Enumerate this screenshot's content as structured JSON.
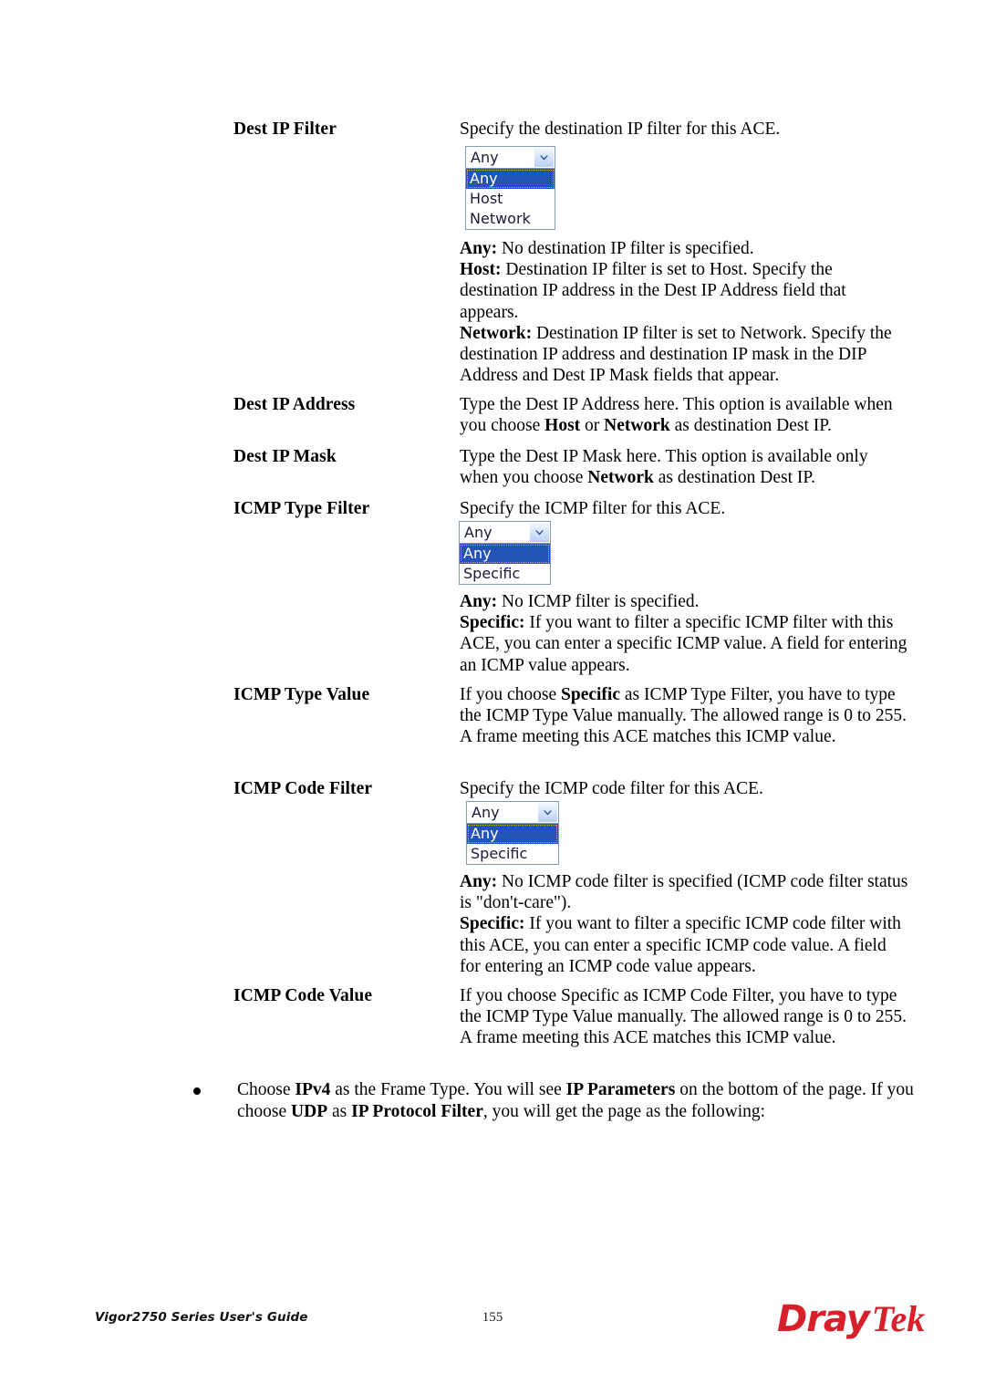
{
  "document": {
    "footer": {
      "left_text": "Vigor2750 Series User's Guide",
      "page_number": "155",
      "logo_part1": "Dray",
      "logo_part2": "Tek",
      "logo_color": "#d8202a"
    }
  },
  "entries": [
    {
      "term": "Dest IP Filter",
      "lead": "Specify the destination IP filter for this ACE.",
      "dropdown": {
        "name": "dest-ip-filter-select",
        "value": "Any",
        "options": [
          "Any",
          "Host",
          "Network"
        ],
        "selected_index": 0,
        "arrow_icon": "chevron-down-icon"
      },
      "details": [
        {
          "label": "Any:",
          "text": " No destination IP filter is specified."
        },
        {
          "label": "Host:",
          "text": " Destination IP filter is set to Host. Specify the destination IP address in the Dest IP Address field that appears."
        },
        {
          "label": "Network:",
          "text": " Destination IP filter is set to Network. Specify the destination IP address and destination IP mask in the DIP Address and Dest IP Mask fields that appear."
        }
      ]
    },
    {
      "term": "Dest IP Address",
      "body_html": "Type the Dest IP Address here. This option is available when you choose <b>Host</b> or <b>Network</b> as destination Dest IP."
    },
    {
      "term": "Dest IP Mask",
      "body_html": "Type the Dest IP Mask here. This option is available only when you choose <b>Network</b> as destination Dest IP."
    },
    {
      "term": "ICMP Type Filter",
      "lead": "Specify the ICMP filter for this ACE.",
      "dropdown": {
        "name": "icmp-type-filter-select",
        "value": "Any",
        "options": [
          "Any",
          "Specific"
        ],
        "selected_index": 0,
        "arrow_icon": "chevron-down-icon"
      },
      "details": [
        {
          "label": "Any:",
          "text": " No ICMP filter is specified."
        },
        {
          "label": "Specific:",
          "text": " If you want to filter a specific ICMP filter with this ACE, you can enter a specific ICMP value. A field for entering an ICMP value appears."
        }
      ]
    },
    {
      "term": "ICMP Type Value",
      "body_html": "If you choose <b>Specific</b> as ICMP Type Filter, you have to type the ICMP Type Value manually. The allowed range is 0 to 255. A frame meeting this ACE matches this ICMP value."
    },
    {
      "term": "ICMP Code Filter",
      "lead": "Specify the ICMP code filter for this ACE.",
      "dropdown": {
        "name": "icmp-code-filter-select",
        "value": "Any",
        "options": [
          "Any",
          "Specific"
        ],
        "selected_index": 0,
        "arrow_icon": "chevron-down-icon"
      },
      "details": [
        {
          "label": "Any:",
          "text": " No ICMP code filter is specified (ICMP code filter status is \"don't-care\")."
        },
        {
          "label": "Specific:",
          "text": " If you want to filter a specific ICMP code filter with this ACE, you can enter a specific ICMP code value. A field for entering an ICMP code value appears."
        }
      ]
    },
    {
      "term": "ICMP Code Value",
      "body_html": "If you choose Specific as ICMP Code Filter, you have to type the ICMP Type Value manually. The allowed range is 0 to 255. A frame meeting this ACE matches this ICMP value."
    }
  ],
  "bullet": {
    "html": "Choose <b>IPv4</b> as the Frame Type. You will see <b>IP Parameters</b> on the bottom of the page. If you choose <b>UDP</b> as <b>IP Protocol Filter</b>, you will get the page as the following:"
  }
}
